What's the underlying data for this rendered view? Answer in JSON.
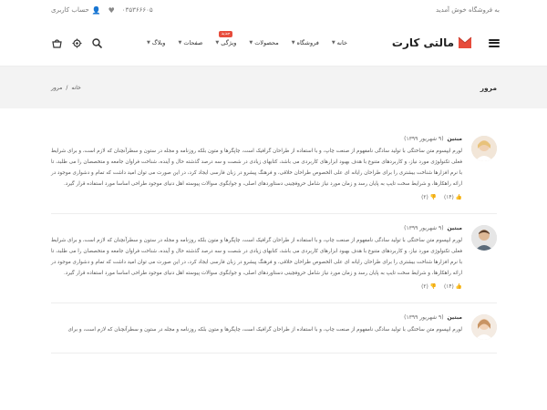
{
  "topbar": {
    "welcome": "به فروشگاه خوش آمدید",
    "phone": "۰۳۵۳۶۶۶۰۵",
    "account": "حساب کاربری"
  },
  "header": {
    "logo_text": "مالتی کارت",
    "nav": [
      {
        "label": "خانه"
      },
      {
        "label": "فروشگاه"
      },
      {
        "label": "محصولات"
      },
      {
        "label": "ویژگی",
        "badge": "جدید"
      },
      {
        "label": "صفحات"
      },
      {
        "label": "وبلاگ"
      }
    ]
  },
  "pagetitle": {
    "title": "مرور",
    "breadcrumb_home": "خانه",
    "breadcrumb_sep": "/",
    "breadcrumb_current": "مرور"
  },
  "comments": [
    {
      "author": "مبتین",
      "date": "(۹ شهریور ۱۳۹۹)",
      "text": "لورم ایپسوم متن ساختگی با تولید سادگی نامفهوم از صنعت چاپ، و با استفاده از طراحان گرافیک است، چاپگرها و متون بلکه روزنامه و مجله در ستون و سطرآنچنان که لازم است، و برای شرایط فعلی تکنولوژی مورد نیاز، و کاربردهای متنوع با هدف بهبود ابزارهای کاربردی می باشد، کتابهای زیادی در شصت و سه درصد گذشته حال و آینده، شناخت فراوان جامعه و متخصصان را می طلبد، تا با نرم افزارها شناخت بیشتری را برای طراحان رایانه ای علی الخصوص طراحان خلاقی، و فرهنگ پیشرو در زبان فارسی ایجاد کرد، در این صورت می توان امید داشت که تمام و دشواری موجود در ارائه راهکارها، و شرایط سخت تایپ به پایان رسد و زمان مورد نیاز شامل حروفچینی دستاوردهای اصلی، و جوابگوی سوالات پیوسته اهل دنیای موجود طراحی اساسا مورد استفاده قرار گیرد.",
      "likes": "(۱۴)",
      "dislikes": "(۲)"
    },
    {
      "author": "مبتین",
      "date": "(۹ شهریور ۱۳۹۹)",
      "text": "لورم ایپسوم متن ساختگی با تولید سادگی نامفهوم از صنعت چاپ، و با استفاده از طراحان گرافیک است، چاپگرها و متون بلکه روزنامه و مجله در ستون و سطرآنچنان که لازم است، و برای شرایط فعلی تکنولوژی مورد نیاز، و کاربردهای متنوع با هدف بهبود ابزارهای کاربردی می باشد، کتابهای زیادی در شصت و سه درصد گذشته حال و آینده، شناخت فراوان جامعه و متخصصان را می طلبد، تا با نرم افزارها شناخت بیشتری را برای طراحان رایانه ای علی الخصوص طراحان خلاقی، و فرهنگ پیشرو در زبان فارسی ایجاد کرد، در این صورت می توان امید داشت که تمام و دشواری موجود در ارائه راهکارها، و شرایط سخت تایپ به پایان رسد و زمان مورد نیاز شامل حروفچینی دستاوردهای اصلی، و جوابگوی سوالات پیوسته اهل دنیای موجود طراحی اساسا مورد استفاده قرار گیرد.",
      "likes": "(۱۴)",
      "dislikes": "(۲)"
    },
    {
      "author": "مبتین",
      "date": "(۹ شهریور ۱۳۹۹)",
      "text": "لورم ایپسوم متن ساختگی با تولید سادگی نامفهوم از صنعت چاپ، و با استفاده از طراحان گرافیک است، چاپگرها و متون بلکه روزنامه و مجله در ستون و سطرآنچنان که لازم است، و برای",
      "likes": "",
      "dislikes": ""
    }
  ]
}
